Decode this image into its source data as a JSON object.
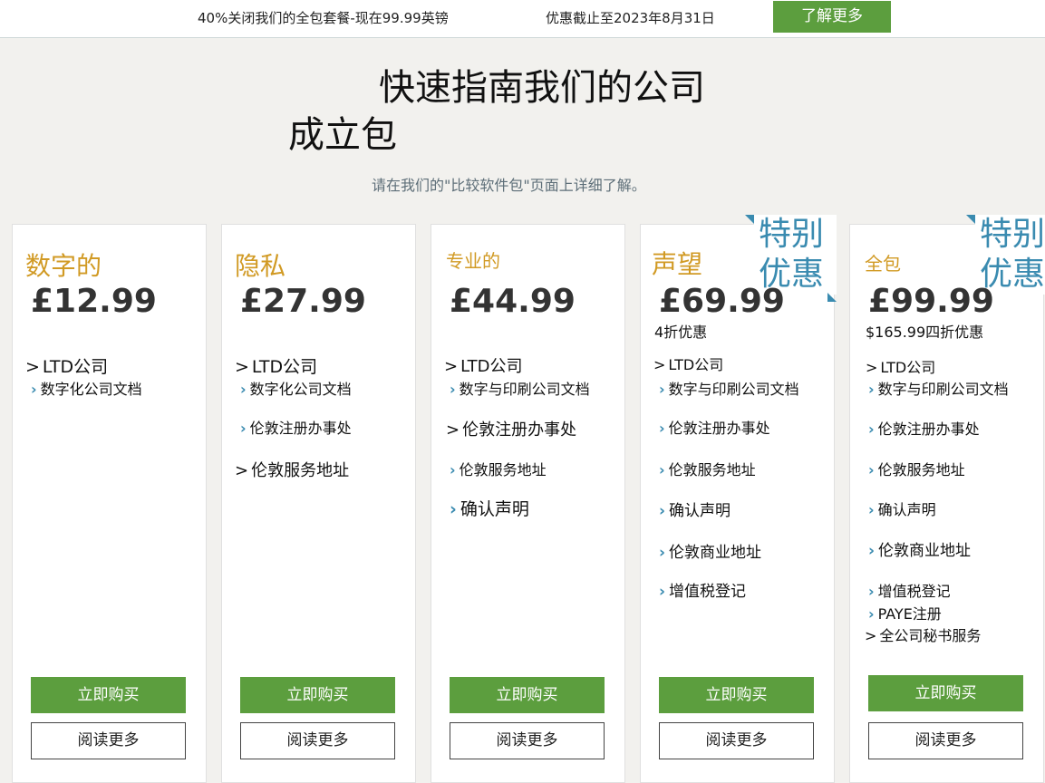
{
  "topbar": {
    "promo_left": "40%关闭我们的全包套餐-现在99.99英镑",
    "promo_right": "优惠截止至2023年8月31日",
    "learn_more": "了解更多"
  },
  "heading": {
    "line1": "快速指南我们的公司",
    "line2": "成立包",
    "subtitle": "请在我们的\"比较软件包\"页面上详细了解。"
  },
  "badge_text_line1": "特别",
  "badge_text_line2": "优惠",
  "colors": {
    "accent_green": "#5c9e3e",
    "package_gold": "#d19a24",
    "badge_blue": "#3a8bb0"
  },
  "packages": [
    {
      "name": "数字的",
      "price": "£12.99",
      "features": [
        "LTD公司",
        "数字化公司文档"
      ],
      "buy": "立即购买",
      "read_more": "阅读更多"
    },
    {
      "name": "隐私",
      "price": "£27.99",
      "features": [
        "LTD公司",
        "数字化公司文档",
        "伦敦注册办事处",
        "伦敦服务地址"
      ],
      "buy": "立即购买",
      "read_more": "阅读更多"
    },
    {
      "name": "专业的",
      "price": "£44.99",
      "features": [
        "LTD公司",
        "数字与印刷公司文档",
        "伦敦注册办事处",
        "伦敦服务地址",
        "确认声明"
      ],
      "buy": "立即购买",
      "read_more": "阅读更多"
    },
    {
      "name": "声望",
      "price": "£69.99",
      "note": "4折优惠",
      "features": [
        "LTD公司",
        "数字与印刷公司文档",
        "伦敦注册办事处",
        "伦敦服务地址",
        "确认声明",
        "伦敦商业地址",
        "增值税登记"
      ],
      "buy": "立即购买",
      "read_more": "阅读更多"
    },
    {
      "name": "全包",
      "price": "£99.99",
      "note": "$165.99四折优惠",
      "features": [
        "LTD公司",
        "数字与印刷公司文档",
        "伦敦注册办事处",
        "伦敦服务地址",
        "确认声明",
        "伦敦商业地址",
        "增值税登记",
        "PAYE注册",
        "全公司秘书服务"
      ],
      "buy": "立即购买",
      "read_more": "阅读更多"
    }
  ]
}
